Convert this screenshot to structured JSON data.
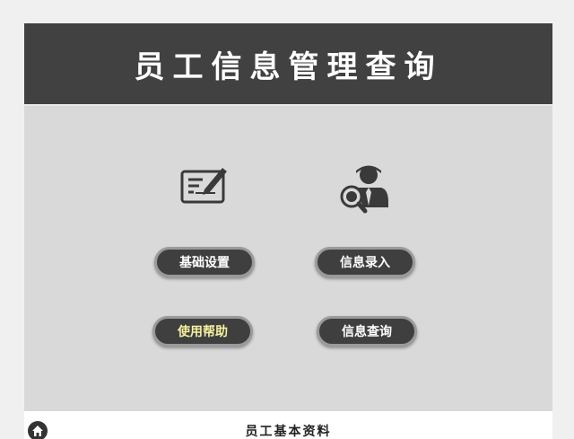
{
  "header": {
    "title": "员工信息管理查询"
  },
  "menu": {
    "basic_settings": "基础设置",
    "info_entry": "信息录入",
    "help": "使用帮助",
    "info_query": "信息查询"
  },
  "footer": {
    "title": "员工基本资料"
  },
  "icons": {
    "edit": "document-edit-icon",
    "query": "person-search-icon",
    "home": "home-icon"
  },
  "colors": {
    "banner": "#414141",
    "panel": "#d9d9d9",
    "button": "#3f3f3f",
    "help_text": "#f5f0a0"
  }
}
